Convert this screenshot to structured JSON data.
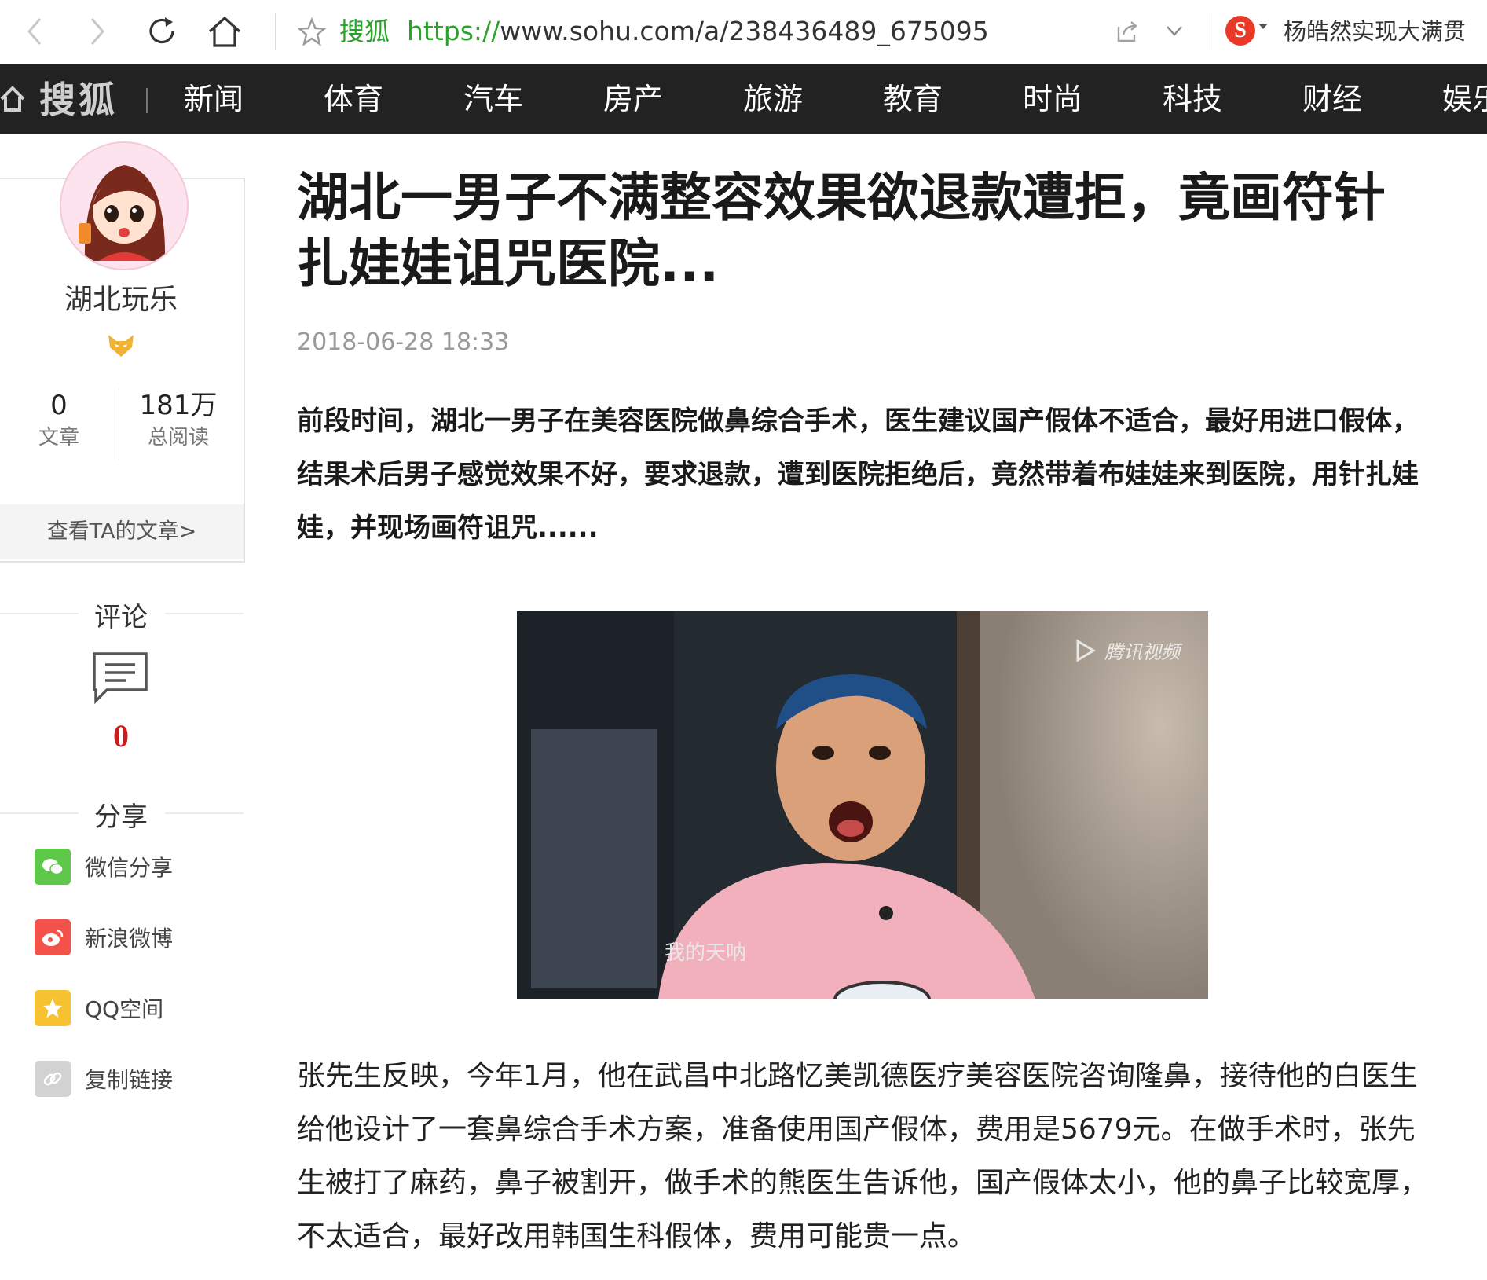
{
  "browser": {
    "site_label": "搜狐",
    "url_protocol": "https://",
    "url_rest": "www.sohu.com/a/238436489_675095",
    "hot_search": "杨皓然实现大满贯",
    "search_engine_icon": "sogou-logo-icon",
    "sogou_letter": "S"
  },
  "sitenav": {
    "brand": "搜狐",
    "items": [
      "新闻",
      "体育",
      "汽车",
      "房产",
      "旅游",
      "教育",
      "时尚",
      "科技",
      "财经",
      "娱乐"
    ]
  },
  "author": {
    "name": "湖北玩乐",
    "articles_count": "0",
    "articles_label": "文章",
    "reads_count": "181万",
    "reads_label": "总阅读",
    "view_articles": "查看TA的文章>"
  },
  "sidebar": {
    "comments_heading": "评论",
    "comments_count": "0",
    "share_heading": "分享",
    "share_items": [
      {
        "label": "微信分享",
        "icon": "wechat-icon",
        "color": "#5dc84a"
      },
      {
        "label": "新浪微博",
        "icon": "weibo-icon",
        "color": "#f2524a"
      },
      {
        "label": "QQ空间",
        "icon": "qzone-icon",
        "color": "#f7c232"
      },
      {
        "label": "复制链接",
        "icon": "link-icon",
        "color": "#d2d2d2"
      }
    ]
  },
  "article": {
    "title": "湖北一男子不满整容效果欲退款遭拒，竟画符针扎娃娃诅咒医院...",
    "date": "2018-06-28 18:33",
    "lead": "前段时间，湖北一男子在美容医院做鼻综合手术，医生建议国产假体不适合，最好用进口假体，结果术后男子感觉效果不好，要求退款，遭到医院拒绝后，竟然带着布娃娃来到医院，用针扎娃娃，并现场画符诅咒......",
    "figure_watermark": "腾讯视频",
    "figure_caption": "我的天呐",
    "body": "张先生反映，今年1月，他在武昌中北路忆美凯德医疗美容医院咨询隆鼻，接待他的白医生给他设计了一套鼻综合手术方案，准备使用国产假体，费用是5679元。在做手术时，张先生被打了麻药，鼻子被割开，做手术的熊医生告诉他，国产假体太小，他的鼻子比较宽厚，不太适合，最好改用韩国生科假体，费用可能贵一点。"
  },
  "colors": {
    "nav_bg": "#222222",
    "url_green": "#2aa32a",
    "comment_red": "#c81e1e"
  }
}
